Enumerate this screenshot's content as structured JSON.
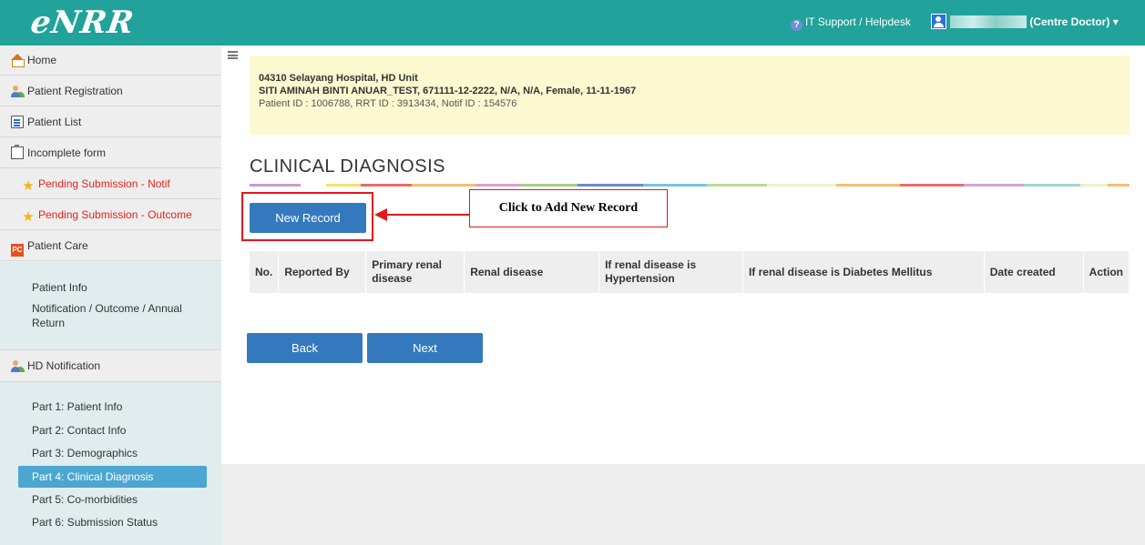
{
  "app": {
    "logo": "eNRR"
  },
  "header": {
    "helpdesk_label": "IT Support / Helpdesk",
    "user_role_label": "(Centre Doctor)",
    "user_caret": "▾",
    "color": "#21a29a"
  },
  "sidebar": {
    "items": [
      {
        "label": "Home",
        "icon": "home-icon"
      },
      {
        "label": "Patient Registration",
        "icon": "people-icon"
      },
      {
        "label": "Patient List",
        "icon": "list-icon"
      },
      {
        "label": "Incomplete form",
        "icon": "clipboard-icon"
      },
      {
        "label": "Pending Submission - Notif",
        "icon": "star-icon"
      },
      {
        "label": "Pending Submission - Outcome",
        "icon": "star-icon"
      },
      {
        "label": "Patient Care",
        "icon": "pc-icon",
        "icon_text": "PC"
      }
    ],
    "patient_care_links": [
      {
        "label": "Patient Info"
      },
      {
        "label": "Notification / Outcome / Annual Return"
      }
    ],
    "hd_notification": {
      "label": "HD Notification",
      "icon": "people-icon"
    },
    "hd_links": [
      {
        "label": "Part 1: Patient Info"
      },
      {
        "label": "Part 2: Contact Info"
      },
      {
        "label": "Part 3: Demographics"
      },
      {
        "label": "Part 4: Clinical Diagnosis",
        "active": true
      },
      {
        "label": "Part 5: Co-morbidities"
      },
      {
        "label": "Part 6: Submission Status"
      }
    ]
  },
  "patient_info": {
    "line1": "04310 Selayang Hospital, HD Unit",
    "line2": "SITI AMINAH BINTI ANUAR_TEST, 671111-12-2222, N/A, N/A, Female, 11-11-1967",
    "line3": "Patient ID : 1006788, RRT ID : 3913434, Notif ID : 154576"
  },
  "page": {
    "title": "CLINICAL DIAGNOSIS",
    "new_record_label": "New Record",
    "callout_text": "Click to Add New Record",
    "back_label": "Back",
    "next_label": "Next"
  },
  "table": {
    "headers": [
      "No.",
      "Reported By",
      "Primary renal disease",
      "Renal disease",
      "If renal disease is Hypertension",
      "If renal disease is Diabetes Mellitus",
      "Date created",
      "Action"
    ],
    "rows": []
  },
  "colors": {
    "accent": "#3479bd",
    "active_nav": "#4ba6d1",
    "warning_text": "#e8231b",
    "info_bg": "#fcf8cf",
    "annotation_red": "#e3171b"
  }
}
